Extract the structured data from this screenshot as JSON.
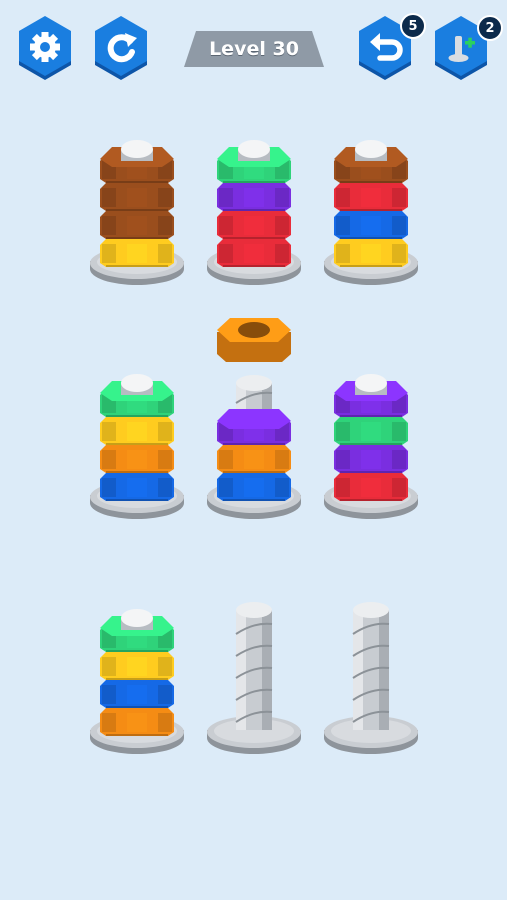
{
  "header": {
    "settings_icon": "gear-icon",
    "restart_icon": "restart-icon",
    "level_label": "Level 30",
    "undo_icon": "undo-icon",
    "undo_count": "5",
    "add_bolt_icon": "add-bolt-icon",
    "add_bolt_count": "2"
  },
  "colors": {
    "button_blue": "#1a7ee0",
    "button_dark": "#0d55a8",
    "banner_gray": "#8f9aa6",
    "brown": "#9a4e1d",
    "yellow": "#ffcc1f",
    "red": "#e92c3a",
    "blue": "#1569e6",
    "green": "#2fd37a",
    "purple": "#7a2ee0",
    "orange": "#f58c14"
  },
  "lifted_nut": "orange",
  "bolts": [
    {
      "id": "bolt-1",
      "nuts_bottom_to_top": [
        "yellow",
        "brown",
        "brown",
        "brown"
      ]
    },
    {
      "id": "bolt-2",
      "nuts_bottom_to_top": [
        "red",
        "red",
        "purple",
        "green"
      ]
    },
    {
      "id": "bolt-3",
      "nuts_bottom_to_top": [
        "yellow",
        "blue",
        "red",
        "brown"
      ]
    },
    {
      "id": "bolt-4",
      "nuts_bottom_to_top": [
        "blue",
        "orange",
        "yellow",
        "green"
      ]
    },
    {
      "id": "bolt-5",
      "nuts_bottom_to_top": [
        "blue",
        "orange",
        "purple"
      ]
    },
    {
      "id": "bolt-6",
      "nuts_bottom_to_top": [
        "red",
        "purple",
        "green",
        "purple"
      ]
    },
    {
      "id": "bolt-7",
      "nuts_bottom_to_top": [
        "orange",
        "blue",
        "yellow",
        "green"
      ]
    },
    {
      "id": "bolt-8",
      "nuts_bottom_to_top": []
    },
    {
      "id": "bolt-9",
      "nuts_bottom_to_top": []
    }
  ]
}
